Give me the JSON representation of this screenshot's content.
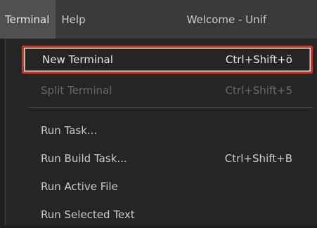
{
  "menubar": {
    "items": [
      "Terminal",
      "Help"
    ],
    "window_title": "Welcome - Unif"
  },
  "terminal_menu": {
    "items": [
      {
        "label": "New Terminal",
        "shortcut": "Ctrl+Shift+ö",
        "enabled": true,
        "highlighted": true
      },
      {
        "label": "Split Terminal",
        "shortcut": "Ctrl+Shift+5",
        "enabled": false
      },
      {
        "label": "Run Task...",
        "shortcut": "",
        "enabled": true
      },
      {
        "label": "Run Build Task...",
        "shortcut": "Ctrl+Shift+B",
        "enabled": true
      },
      {
        "label": "Run Active File",
        "shortcut": "",
        "enabled": true
      },
      {
        "label": "Run Selected Text",
        "shortcut": "",
        "enabled": true
      }
    ]
  },
  "colors": {
    "highlight_border": "#c0392b",
    "menubar_bg": "#3a3a3a",
    "menu_bg": "#252526"
  }
}
